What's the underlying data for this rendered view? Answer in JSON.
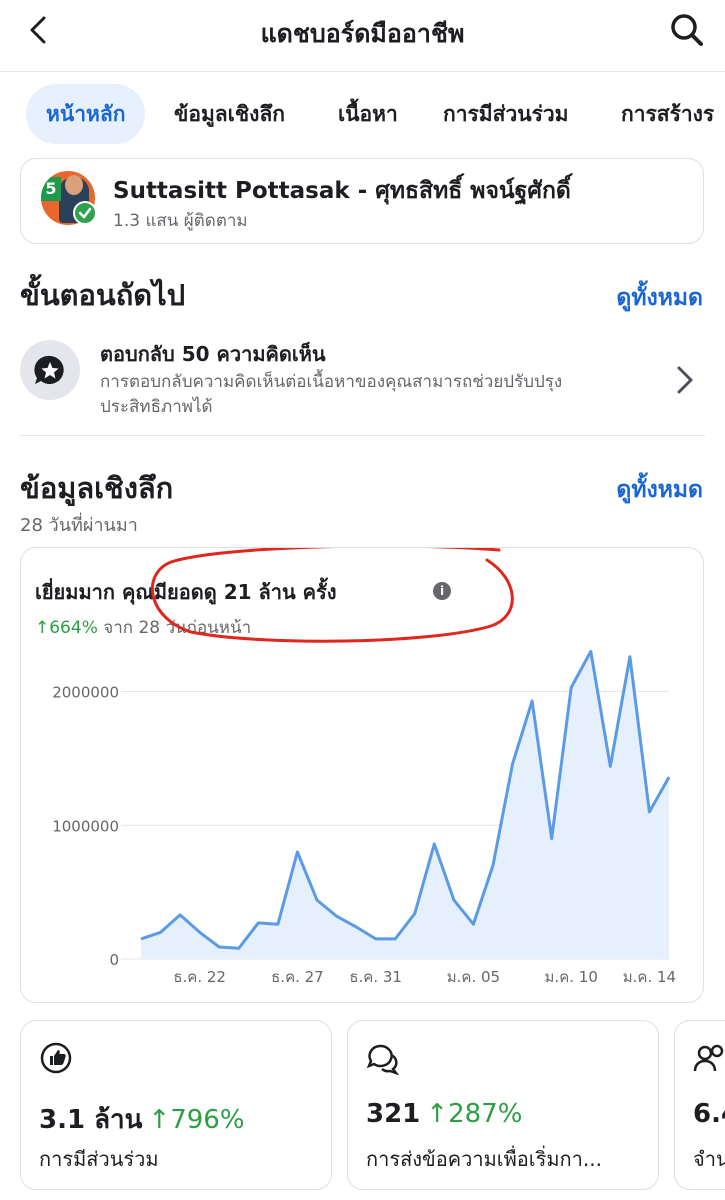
{
  "header": {
    "title": "แดชบอร์ดมืออาชีพ",
    "back_icon": "chevron-left-icon",
    "search_icon": "search-icon"
  },
  "tabs": [
    {
      "label": "หน้าหลัก",
      "active": true
    },
    {
      "label": "ข้อมูลเชิงลึก"
    },
    {
      "label": "เนื้อหา"
    },
    {
      "label": "การมีส่วนร่วม"
    },
    {
      "label": "การสร้างร"
    }
  ],
  "profile": {
    "name": "Suttasitt Pottasak - ศุทธสิทธิ์ พจน์ฐศักดิ์",
    "followers": "1.3 แสน ผู้ติดตาม",
    "badge": "5"
  },
  "next_steps": {
    "title": "ขั้นตอนถัดไป",
    "see_all": "ดูทั้งหมด",
    "item": {
      "title": "ตอบกลับ 50 ความคิดเห็น",
      "desc": "การตอบกลับความคิดเห็นต่อเนื้อหาของคุณสามารถช่วยปรับปรุงประสิทธิภาพได้"
    }
  },
  "insights": {
    "title": "ข้อมูลเชิงลึก",
    "see_all": "ดูทั้งหมด",
    "period": "28 วันที่ผ่านมา",
    "headline": "เยี่ยมมาก คุณมียอดดู 21 ล้าน ครั้ง",
    "change_value": "↑664%",
    "change_text": "จาก 28 วันก่อนหน้า"
  },
  "chart_data": {
    "type": "area",
    "y_ticks": [
      "2000000",
      "1000000",
      "0"
    ],
    "x_tick_labels": [
      "ธ.ค. 22",
      "ธ.ค. 27",
      "ธ.ค. 31",
      "ม.ค. 05",
      "ม.ค. 10",
      "ม.ค. 14"
    ],
    "x_tick_index": [
      3,
      8,
      12,
      17,
      22,
      26
    ],
    "ylim": [
      0,
      2400000
    ],
    "values": [
      150000,
      200000,
      330000,
      200000,
      90000,
      80000,
      270000,
      260000,
      800000,
      440000,
      320000,
      240000,
      150000,
      150000,
      340000,
      860000,
      440000,
      260000,
      700000,
      1460000,
      1930000,
      900000,
      2030000,
      2300000,
      1440000,
      2260000,
      1100000,
      1360000
    ],
    "line_color": "#5b9be6",
    "fill_color": "#e6f0fc",
    "grid": true
  },
  "stats": [
    {
      "value": "3.1 ล้าน",
      "change": "↑796%",
      "label": "การมีส่วนร่วม",
      "icon": "thumbs-up-icon"
    },
    {
      "value": "321",
      "change": "↑287%",
      "label": "การส่งข้อความเพื่อเริ่มกา...",
      "icon": "chat-bubbles-icon"
    },
    {
      "value": "6.4",
      "change": "",
      "label": "จำน",
      "icon": "people-icon"
    }
  ]
}
